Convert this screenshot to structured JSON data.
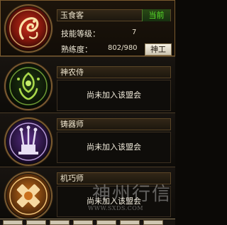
{
  "professions": [
    {
      "name": "玉食客",
      "status_badge": "当前",
      "skill_level_label": "技能等级：",
      "skill_level_value": "7",
      "proficiency_label": "熟练度：",
      "proficiency_value": "802/980",
      "title_button": "神工",
      "emblem_icon": "red-dragon-emblem-icon"
    },
    {
      "name": "神农侍",
      "empty_text": "尚未加入该盟会",
      "emblem_icon": "green-leaf-emblem-icon"
    },
    {
      "name": "铸器师",
      "empty_text": "尚未加入该盟会",
      "emblem_icon": "purple-forge-emblem-icon"
    },
    {
      "name": "机巧师",
      "empty_text": "尚未加入该盟会",
      "emblem_icon": "orange-gear-emblem-icon"
    }
  ],
  "watermark": {
    "text": "神州行信",
    "url": "WWW.SXDS.COM"
  },
  "colors": {
    "current_badge": "#59e32a",
    "text": "#efe6cf",
    "active_border": "#7a5a2e"
  }
}
